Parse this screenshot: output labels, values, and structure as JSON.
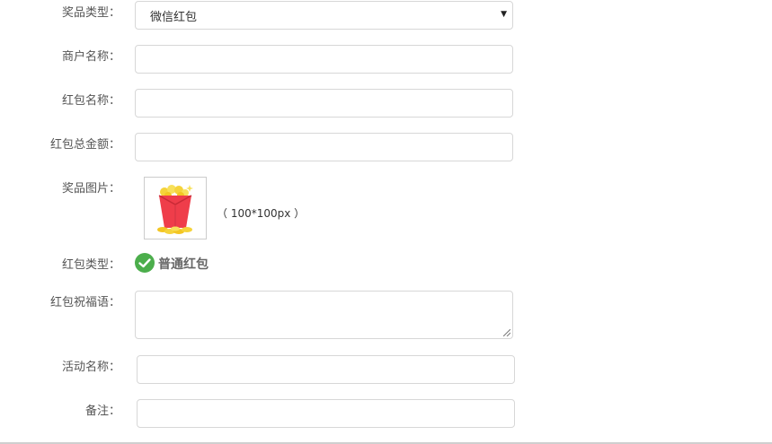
{
  "form": {
    "prize_type": {
      "label": "奖品类型：",
      "value": "微信红包"
    },
    "merchant_name": {
      "label": "商户名称：",
      "value": ""
    },
    "redpack_name": {
      "label": "红包名称：",
      "value": ""
    },
    "redpack_total": {
      "label": "红包总金额：",
      "value": ""
    },
    "prize_image": {
      "label": "奖品图片：",
      "size_hint": "（ 100*100px ）",
      "icon": "red-packet-popcorn-image"
    },
    "redpack_type": {
      "label": "红包类型：",
      "value": "普通红包",
      "icon": "check-circle-icon",
      "color": "#4cae4c"
    },
    "blessing": {
      "label": "红包祝福语：",
      "value": ""
    },
    "activity_name": {
      "label": "活动名称：",
      "value": ""
    },
    "remark": {
      "label": "备注：",
      "value": ""
    }
  }
}
